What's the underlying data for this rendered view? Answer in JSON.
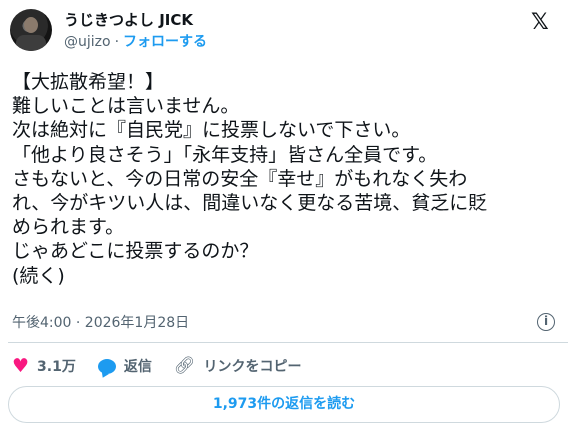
{
  "author": {
    "display_name": "うじきつよし JICK",
    "handle": "@ujizo",
    "separator": "·",
    "follow_label": "フォローする"
  },
  "platform_logo": "𝕏",
  "tweet": {
    "text": "【大拡散希望！】\n難しいことは言いません。\n次は絶対に『自民党』に投票しないで下さい。\n「他より良さそう」「永年支持」皆さん全員です。\nさもないと、今の日常の安全『幸せ』がもれなく失わ\nれ、今がキツい人は、間違いなく更なる苦境、貧乏に貶\nめられます。\nじゃあどこに投票するのか？\n(続く)",
    "timestamp": "午後4:00 · 2026年1月28日"
  },
  "actions": {
    "like_count": "3.1万",
    "reply_label": "返信",
    "copy_link_label": "リンクをコピー"
  },
  "read_replies_label": "1,973件の返信を読む",
  "icons": {
    "heart": "heart-icon",
    "reply": "reply-bubble-icon",
    "link": "link-icon",
    "info": "info-icon",
    "logo": "x-logo-icon"
  },
  "colors": {
    "accent": "#1d9bf0",
    "like": "#f91880",
    "secondary_text": "#536471",
    "border": "#cfd9de"
  }
}
